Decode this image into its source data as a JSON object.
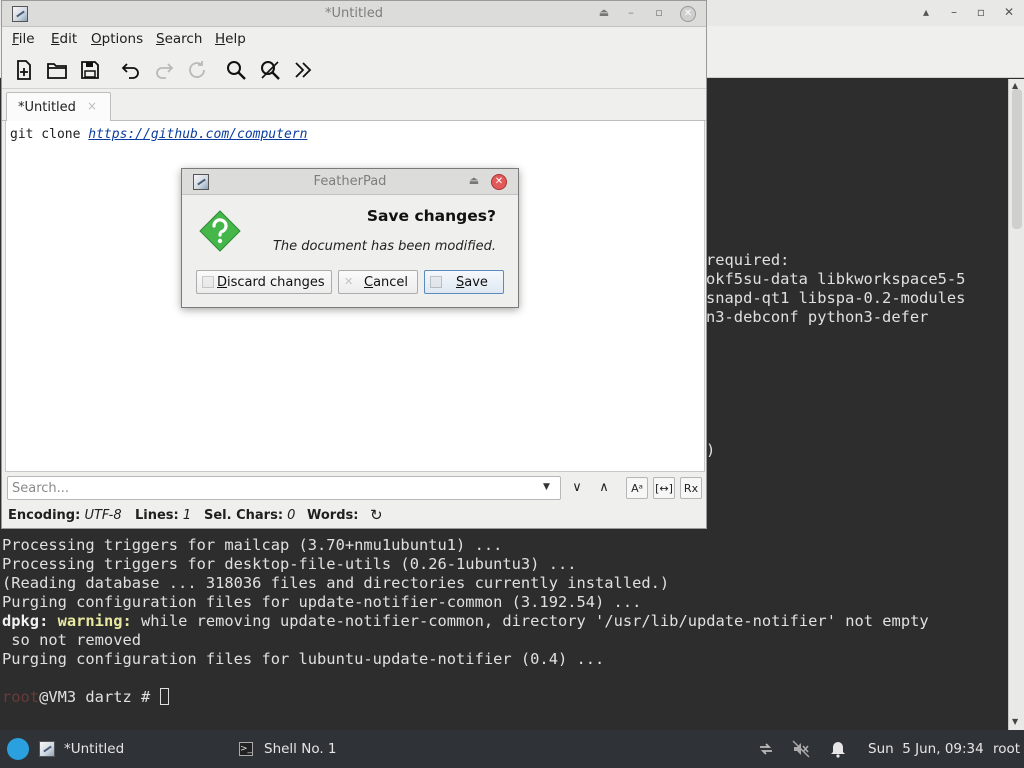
{
  "terminal": {
    "lines_top": [
      {
        "text": "required:"
      },
      {
        "text": "okf5su-data libkworkspace5-5"
      },
      {
        "text": "snapd-qt1 libspa-0.2-modules"
      },
      {
        "text": "n3-debconf python3-defer"
      },
      {
        "text": ")"
      }
    ],
    "lines_bottom": [
      "Processing triggers for mailcap (3.70+nmu1ubuntu1) ...",
      "Processing triggers for desktop-file-utils (0.26-1ubuntu3) ...",
      "(Reading database ... 318036 files and directories currently installed.)",
      "Purging configuration files for update-notifier-common (3.192.54) ...",
      "",
      " so not removed",
      "Purging configuration files for lubuntu-update-notifier (0.4) ..."
    ],
    "warning_line": {
      "prefix": "dpkg:",
      "label": " warning:",
      "rest": " while removing update-notifier-common, directory '/usr/lib/update-notifier' not empty"
    },
    "prompt": {
      "user": "root",
      "host": "@VM3 dartz # "
    }
  },
  "featherpad": {
    "window_title": "*Untitled",
    "menu": [
      {
        "pre": "",
        "ul": "F",
        "post": "ile"
      },
      {
        "pre": "",
        "ul": "E",
        "post": "dit"
      },
      {
        "pre": "",
        "ul": "O",
        "post": "ptions"
      },
      {
        "pre": "",
        "ul": "S",
        "post": "earch"
      },
      {
        "pre": "",
        "ul": "H",
        "post": "elp"
      }
    ],
    "toolbar_icons": [
      "new-file-icon",
      "open-folder-icon",
      "save-icon",
      "undo-icon",
      "redo-icon",
      "reload-icon",
      "find-icon",
      "replace-icon",
      "more-icon"
    ],
    "tab_label": "*Untitled",
    "tab_close": "×",
    "editor": {
      "prefix": "git clone ",
      "link": "https://github.com/computern"
    },
    "search": {
      "placeholder": "Search..."
    },
    "status": {
      "encoding_label": "Encoding:",
      "encoding_value": "UTF-8",
      "lines_label": "Lines:",
      "lines_value": "1",
      "sel_label": "Sel. Chars:",
      "sel_value": "0",
      "words_label": "Words:"
    }
  },
  "dialog": {
    "title": "FeatherPad",
    "heading": "Save changes?",
    "message": "The document has been modified.",
    "buttons": {
      "discard": {
        "ul": "D",
        "rest": "iscard changes"
      },
      "cancel": {
        "ul": "C",
        "rest": "ancel"
      },
      "save": {
        "ul": "S",
        "rest": "ave"
      }
    },
    "icon_color": "#45b649"
  },
  "taskbar": {
    "task1": "*Untitled",
    "task2": "Shell No. 1",
    "clock": "Sun  5 Jun, 09:34",
    "user": "root"
  },
  "colors": {
    "terminal_bg": "#2d2d2d",
    "link": "#0b3da0",
    "taskbar_bg": "#2f3237"
  }
}
